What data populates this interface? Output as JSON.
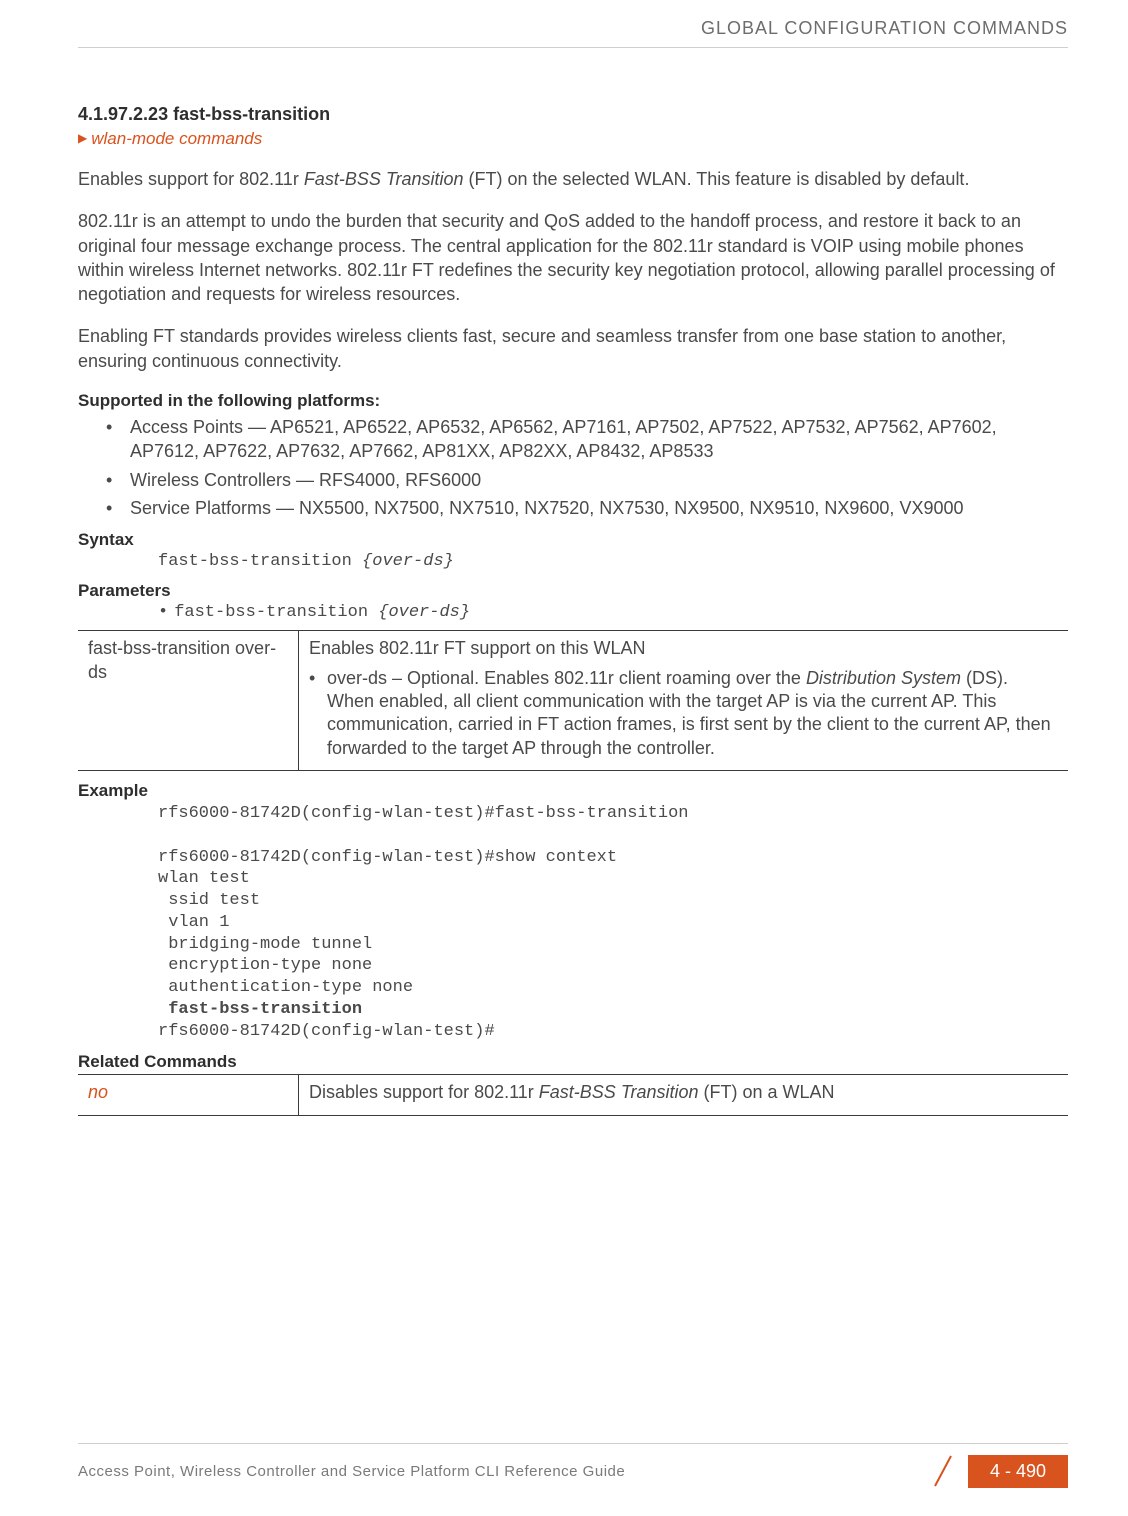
{
  "running_head": "GLOBAL CONFIGURATION COMMANDS",
  "section": {
    "number": "4.1.97.2.23",
    "title": "fast-bss-transition"
  },
  "breadcrumb": "wlan-mode commands",
  "paragraphs": {
    "p1_a": "Enables support for 802.11r ",
    "p1_em": "Fast-BSS Transition",
    "p1_b": " (FT) on the selected WLAN. This feature is disabled by default.",
    "p2": "802.11r is an attempt to undo the burden that security and QoS added to the handoff process, and restore it back to an original four message exchange process. The central application for the 802.11r standard is VOIP using mobile phones within wireless Internet networks. 802.11r FT redefines the security key negotiation protocol, allowing parallel processing of negotiation and requests for wireless resources.",
    "p3": "Enabling FT standards provides wireless clients fast, secure and seamless transfer from one base station to another, ensuring continuous connectivity."
  },
  "supported": {
    "heading": "Supported in the following platforms:",
    "items": [
      "Access Points — AP6521, AP6522, AP6532, AP6562, AP7161, AP7502, AP7522, AP7532, AP7562, AP7602, AP7612, AP7622, AP7632, AP7662, AP81XX, AP82XX, AP8432, AP8533",
      "Wireless Controllers — RFS4000, RFS6000",
      "Service Platforms — NX5500, NX7500, NX7510, NX7520, NX7530, NX9500, NX9510, NX9600, VX9000"
    ]
  },
  "syntax": {
    "heading": "Syntax",
    "code_plain": "fast-bss-transition ",
    "code_em": "{over-ds}"
  },
  "parameters": {
    "heading": "Parameters",
    "line_plain": "fast-bss-transition ",
    "line_em": "{over-ds}",
    "table": {
      "left": "fast-bss-transition over-ds",
      "right_main": "Enables 802.11r FT support on this WLAN",
      "right_bullet_a": "over-ds – Optional. Enables 802.11r client roaming over the ",
      "right_bullet_em": "Distribution System",
      "right_bullet_b": " (DS). When enabled, all client communication with the target AP is via the current AP. This communication, carried in FT action frames, is first sent by the client to the current AP, then forwarded to the target AP through the controller."
    }
  },
  "example": {
    "heading": "Example",
    "lines_pre": "rfs6000-81742D(config-wlan-test)#fast-bss-transition\n\nrfs6000-81742D(config-wlan-test)#show context\nwlan test\n ssid test\n vlan 1\n bridging-mode tunnel\n encryption-type none\n authentication-type none",
    "line_bold": " fast-bss-transition",
    "lines_post": "rfs6000-81742D(config-wlan-test)#"
  },
  "related": {
    "heading": "Related Commands",
    "table": {
      "left": "no",
      "right_a": "Disables support for 802.11r ",
      "right_em": "Fast-BSS Transition",
      "right_b": " (FT) on a WLAN"
    }
  },
  "footer": {
    "title": "Access Point, Wireless Controller and Service Platform CLI Reference Guide",
    "page": "4 - 490"
  }
}
